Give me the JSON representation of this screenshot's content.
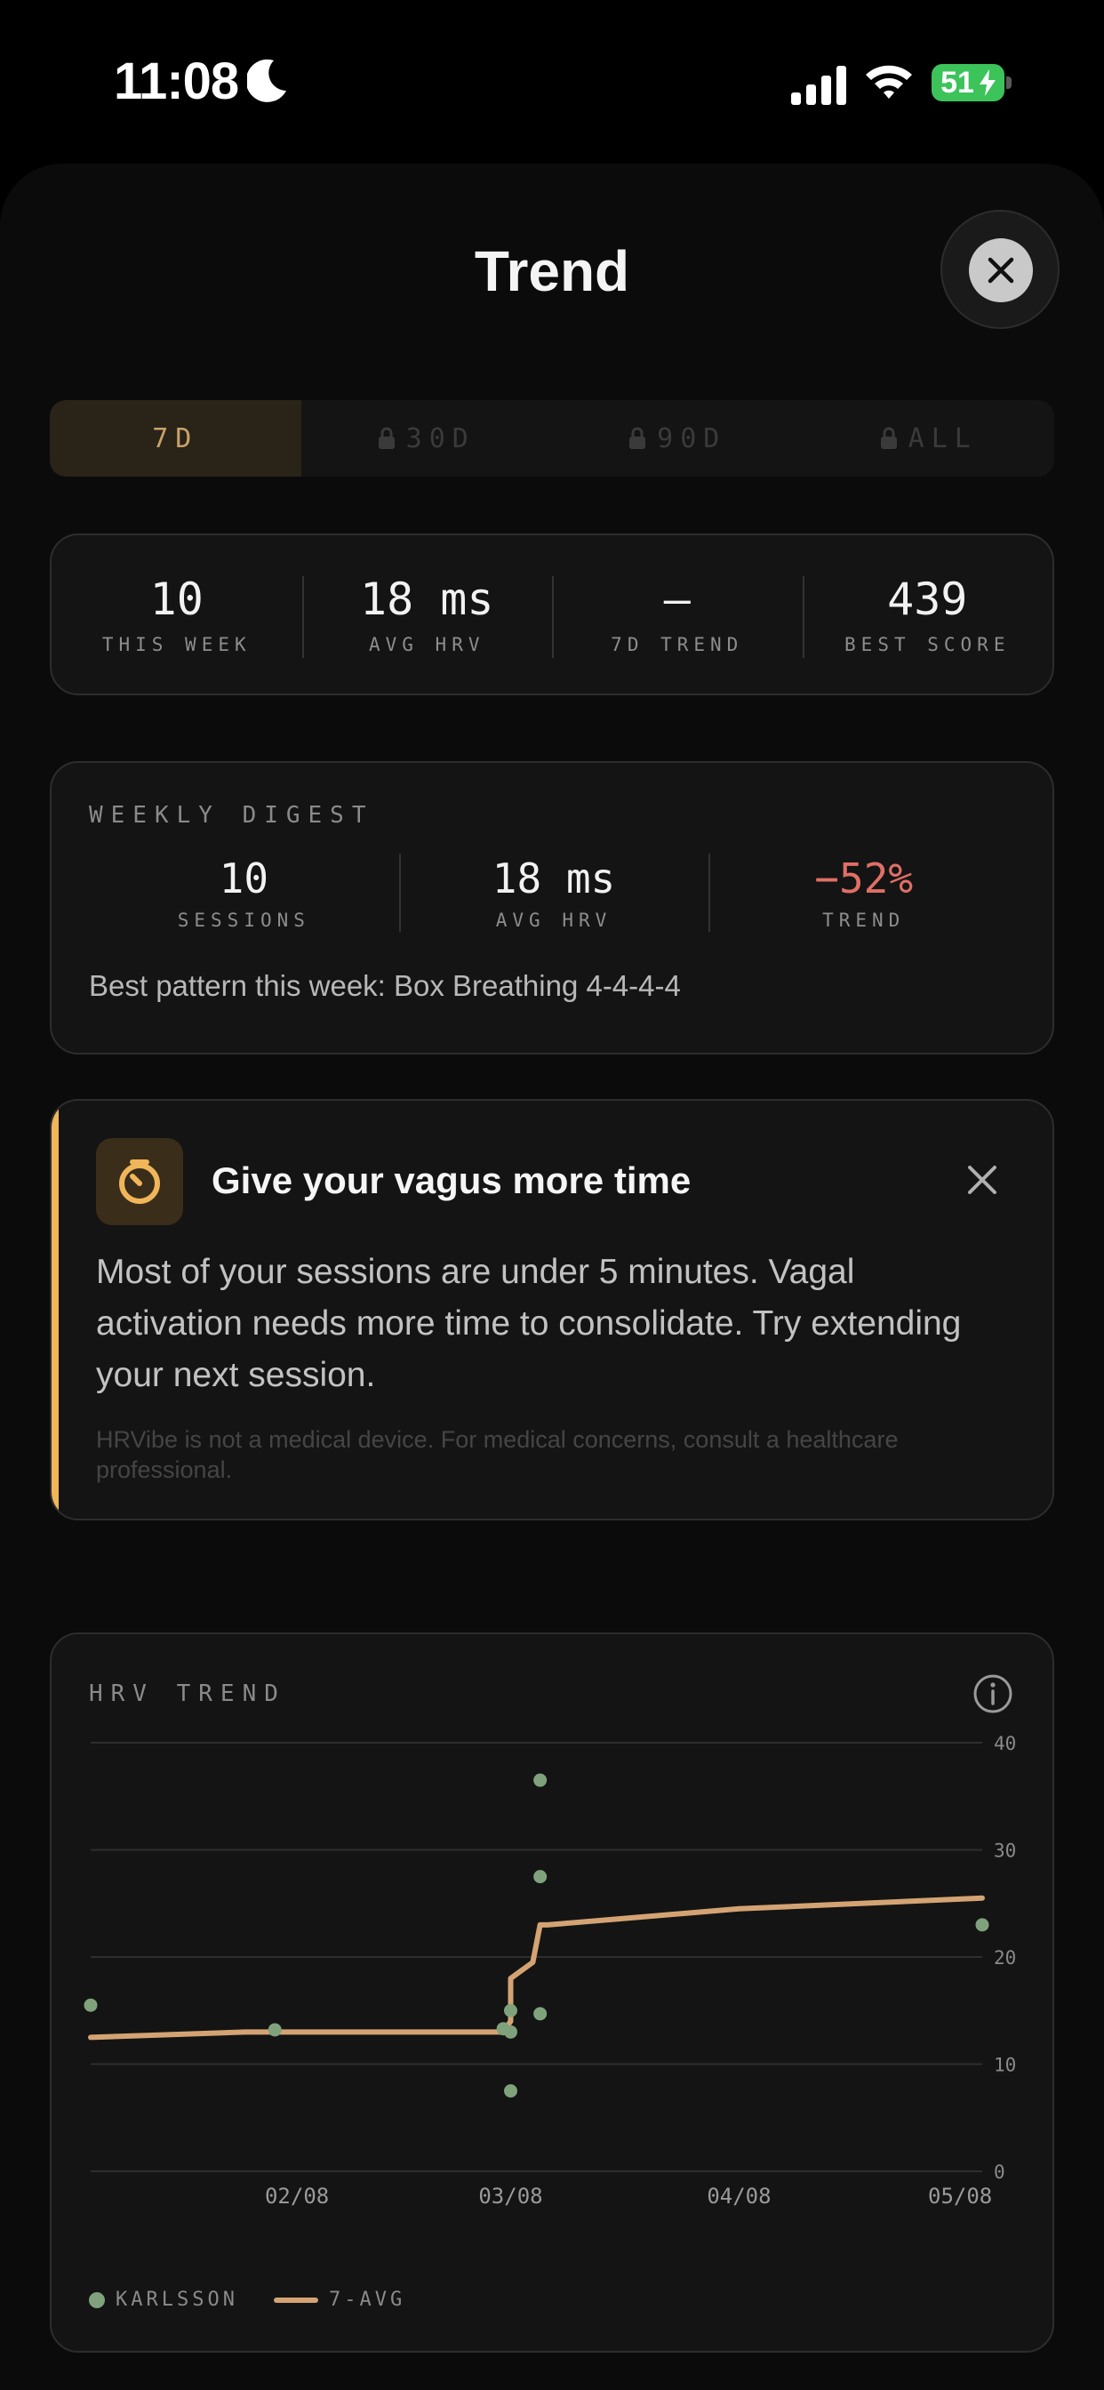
{
  "status": {
    "time": "11:08",
    "battery": "51"
  },
  "header": {
    "title": "Trend"
  },
  "segments": [
    {
      "label": "7D",
      "locked": false,
      "active": true
    },
    {
      "label": "30D",
      "locked": true,
      "active": false
    },
    {
      "label": "90D",
      "locked": true,
      "active": false
    },
    {
      "label": "ALL",
      "locked": true,
      "active": false
    }
  ],
  "stats": [
    {
      "value": "10",
      "label": "THIS WEEK"
    },
    {
      "value": "18 ms",
      "label": "AVG HRV"
    },
    {
      "value": "—",
      "label": "7D TREND"
    },
    {
      "value": "439",
      "label": "BEST SCORE"
    }
  ],
  "digest": {
    "heading": "WEEKLY DIGEST",
    "items": [
      {
        "value": "10",
        "label": "SESSIONS"
      },
      {
        "value": "18 ms",
        "label": "AVG HRV"
      },
      {
        "value": "−52%",
        "label": "TREND"
      }
    ],
    "best": "Best pattern this week: Box Breathing 4-4-4-4"
  },
  "insight": {
    "title": "Give your vagus more time",
    "body": "Most of your sessions are under 5 minutes. Vagal activation needs more time to consolidate. Try extending your next session.",
    "disclaimer": "HRVibe is not a medical device. For medical concerns, consult a healthcare professional.",
    "accent_color": "#f0b659"
  },
  "chart": {
    "heading": "HRV TREND",
    "legend_points": "KARLSSON",
    "legend_line": "7-AVG"
  },
  "chart_data": {
    "type": "scatter",
    "ylim": [
      0,
      40
    ],
    "yticks": [
      0,
      10,
      20,
      30,
      40
    ],
    "xlim": [
      "2024-01-11",
      "2024-05-11"
    ],
    "xticks": [
      "02/08",
      "03/08",
      "04/08",
      "05/08"
    ],
    "series": [
      {
        "name": "KARLSSON",
        "kind": "points",
        "color": "#7fa27c",
        "x": [
          "2024-01-11",
          "2024-02-05",
          "2024-03-07",
          "2024-03-08",
          "2024-03-08",
          "2024-03-08",
          "2024-03-12",
          "2024-03-12",
          "2024-03-12",
          "2024-05-11"
        ],
        "y": [
          15.5,
          13.2,
          13.3,
          15.0,
          13.0,
          7.5,
          36.5,
          27.5,
          14.7,
          23.0
        ]
      },
      {
        "name": "7-AVG",
        "kind": "line",
        "color": "#d4a373",
        "x": [
          "2024-01-11",
          "2024-02-01",
          "2024-03-07",
          "2024-03-08",
          "2024-03-08",
          "2024-03-11",
          "2024-03-12",
          "2024-03-13",
          "2024-04-08",
          "2024-05-11"
        ],
        "y": [
          12.5,
          13.0,
          13.0,
          14.0,
          18.0,
          19.5,
          23.0,
          23.0,
          24.5,
          25.5
        ]
      }
    ]
  }
}
